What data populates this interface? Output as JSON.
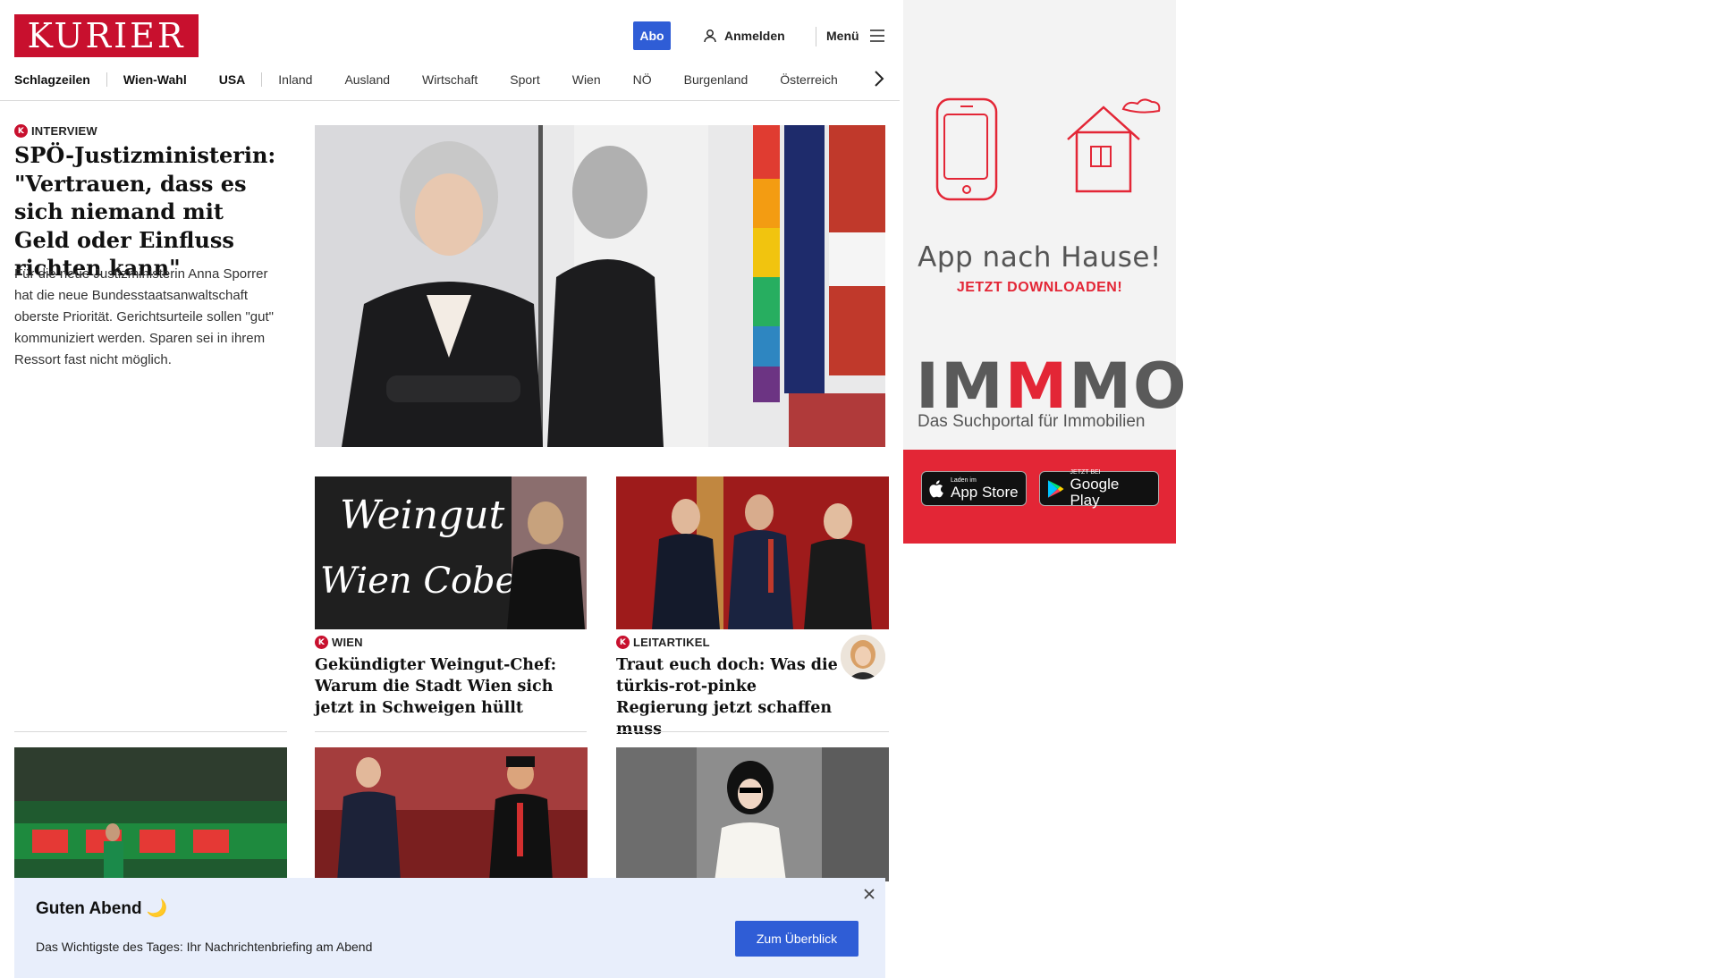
{
  "header": {
    "logo": "KURIER",
    "abo_label": "Abo",
    "login_label": "Anmelden",
    "menu_label": "Menü",
    "nav": [
      "Schlagzeilen",
      "Wien-Wahl",
      "USA",
      "Inland",
      "Ausland",
      "Wirtschaft",
      "Sport",
      "Wien",
      "NÖ",
      "Burgenland",
      "Österreich"
    ]
  },
  "lead": {
    "kicker": "INTERVIEW",
    "title": "SPÖ-Justizministerin: \"Vertrauen, dass es sich niemand mit Geld oder Einfluss richten kann\"",
    "teaser": "Für die neue Justizministerin Anna Sporrer hat die neue Bundesstaatsanwaltschaft oberste Priorität. Gerichtsurteile sollen \"gut\" kommuniziert werden. Sparen sei in ihrem Ressort fast nicht möglich."
  },
  "cards": [
    {
      "kicker": "WIEN",
      "title": "Gekündigter Weingut-Chef: Warum die Stadt Wien sich jetzt in Schweigen hüllt",
      "image_text": [
        "Weingut",
        "Wien Cobenzl"
      ]
    },
    {
      "kicker": "LEITARTIKEL",
      "title": "Traut euch doch: Was die türkis-rot-pinke Regierung jetzt schaffen muss"
    }
  ],
  "briefing": {
    "greeting": "Guten Abend 🌙",
    "description": "Das Wichtigste des Tages: Ihr Nachrichtenbriefing am Abend",
    "cta": "Zum Überblick"
  },
  "ad": {
    "headline": "App nach Hause!",
    "subline": "JETZT DOWNLOADEN!",
    "brand_a": "IM",
    "brand_b": "M",
    "brand_c": "MO",
    "tagline": "Das Suchportal für Immobilien",
    "appstore_small": "Laden im",
    "appstore_big": "App Store",
    "googleplay_small": "JETZT BEI",
    "googleplay_big": "Google Play"
  },
  "colors": {
    "brand_red": "#c8102e",
    "accent_blue": "#2f5dd6",
    "ad_red": "#e32636"
  },
  "icons": [
    "user-icon",
    "hamburger-icon",
    "chevron-right-icon",
    "close-icon",
    "apple-icon",
    "google-play-icon"
  ]
}
